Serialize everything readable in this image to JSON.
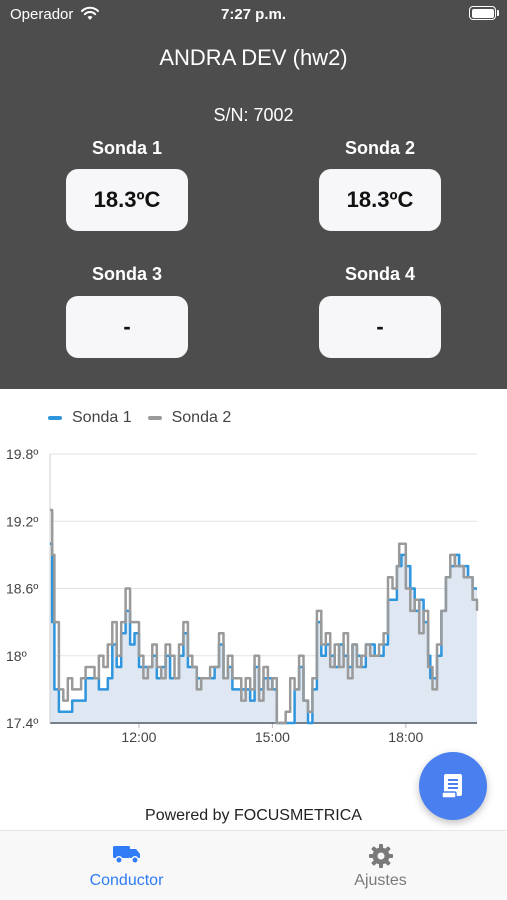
{
  "status_bar": {
    "carrier": "Operador",
    "time": "7:27 p.m."
  },
  "header": {
    "title": "ANDRA DEV (hw2)",
    "serial": "S/N: 7002"
  },
  "probes": [
    {
      "label": "Sonda 1",
      "value": "18.3ºC"
    },
    {
      "label": "Sonda 2",
      "value": "18.3ºC"
    },
    {
      "label": "Sonda 3",
      "value": "-"
    },
    {
      "label": "Sonda 4",
      "value": "-"
    }
  ],
  "colors": {
    "header_bg": "#4d4d4d",
    "sonda1": "#2f95dc",
    "sonda2": "#9a9a9a",
    "area_fill": "#dfe8f2",
    "accent": "#4a7ff0",
    "tab_active": "#2f7cf6",
    "tab_inactive": "#7a7a7a"
  },
  "chart_data": {
    "type": "line",
    "y_ticks": [
      "19.8º",
      "19.2º",
      "18.6º",
      "18º",
      "17.4º"
    ],
    "x_ticks": [
      "12:00",
      "15:00",
      "18:00"
    ],
    "ylim": [
      17.4,
      19.8
    ],
    "xlim": [
      10.0,
      19.6
    ],
    "grid": true,
    "legend_position": "top-left",
    "series": [
      {
        "name": "Sonda 1",
        "points": [
          [
            10.0,
            19.0
          ],
          [
            10.05,
            18.3
          ],
          [
            10.1,
            17.7
          ],
          [
            10.2,
            17.5
          ],
          [
            10.4,
            17.5
          ],
          [
            10.5,
            17.6
          ],
          [
            10.7,
            17.6
          ],
          [
            10.8,
            17.8
          ],
          [
            11.0,
            17.8
          ],
          [
            11.1,
            17.7
          ],
          [
            11.3,
            17.8
          ],
          [
            11.4,
            18.1
          ],
          [
            11.5,
            17.9
          ],
          [
            11.6,
            18.2
          ],
          [
            11.7,
            18.4
          ],
          [
            11.8,
            18.1
          ],
          [
            11.9,
            18.2
          ],
          [
            12.0,
            17.9
          ],
          [
            12.2,
            17.9
          ],
          [
            12.3,
            18.0
          ],
          [
            12.4,
            17.8
          ],
          [
            12.5,
            17.9
          ],
          [
            12.6,
            18.0
          ],
          [
            12.7,
            17.8
          ],
          [
            12.9,
            18.0
          ],
          [
            13.0,
            18.2
          ],
          [
            13.1,
            17.9
          ],
          [
            13.3,
            17.8
          ],
          [
            13.5,
            17.8
          ],
          [
            13.7,
            17.9
          ],
          [
            13.8,
            18.1
          ],
          [
            13.9,
            17.8
          ],
          [
            14.0,
            17.9
          ],
          [
            14.1,
            17.7
          ],
          [
            14.3,
            17.7
          ],
          [
            14.5,
            17.6
          ],
          [
            14.6,
            17.9
          ],
          [
            14.7,
            17.7
          ],
          [
            14.8,
            17.8
          ],
          [
            15.0,
            17.7
          ],
          [
            15.1,
            17.4
          ],
          [
            15.3,
            17.4
          ],
          [
            15.5,
            17.7
          ],
          [
            15.6,
            17.9
          ],
          [
            15.7,
            17.6
          ],
          [
            15.8,
            17.4
          ],
          [
            15.9,
            17.7
          ],
          [
            16.0,
            18.3
          ],
          [
            16.1,
            18.0
          ],
          [
            16.2,
            18.1
          ],
          [
            16.3,
            18.0
          ],
          [
            16.4,
            17.9
          ],
          [
            16.5,
            18.1
          ],
          [
            16.6,
            18.0
          ],
          [
            16.7,
            17.9
          ],
          [
            16.8,
            18.1
          ],
          [
            16.9,
            18.0
          ],
          [
            17.0,
            17.9
          ],
          [
            17.1,
            18.1
          ],
          [
            17.3,
            18.0
          ],
          [
            17.5,
            18.1
          ],
          [
            17.6,
            18.5
          ],
          [
            17.8,
            18.8
          ],
          [
            17.9,
            18.9
          ],
          [
            18.0,
            18.8
          ],
          [
            18.1,
            18.6
          ],
          [
            18.2,
            18.4
          ],
          [
            18.3,
            18.5
          ],
          [
            18.4,
            18.3
          ],
          [
            18.5,
            18.0
          ],
          [
            18.55,
            17.8
          ],
          [
            18.6,
            17.8
          ],
          [
            18.7,
            18.0
          ],
          [
            18.8,
            18.4
          ],
          [
            18.9,
            18.7
          ],
          [
            19.0,
            18.8
          ],
          [
            19.1,
            18.9
          ],
          [
            19.2,
            18.8
          ],
          [
            19.3,
            18.8
          ],
          [
            19.4,
            18.7
          ],
          [
            19.5,
            18.6
          ],
          [
            19.6,
            18.6
          ]
        ]
      },
      {
        "name": "Sonda 2",
        "points": [
          [
            10.0,
            19.3
          ],
          [
            10.05,
            18.9
          ],
          [
            10.1,
            18.3
          ],
          [
            10.2,
            17.7
          ],
          [
            10.3,
            17.6
          ],
          [
            10.4,
            17.8
          ],
          [
            10.5,
            17.7
          ],
          [
            10.6,
            17.7
          ],
          [
            10.7,
            17.8
          ],
          [
            10.8,
            17.9
          ],
          [
            11.0,
            17.8
          ],
          [
            11.1,
            18.0
          ],
          [
            11.2,
            17.9
          ],
          [
            11.3,
            18.1
          ],
          [
            11.4,
            18.3
          ],
          [
            11.5,
            18.0
          ],
          [
            11.6,
            18.3
          ],
          [
            11.7,
            18.6
          ],
          [
            11.8,
            18.3
          ],
          [
            11.9,
            18.3
          ],
          [
            12.0,
            18.0
          ],
          [
            12.1,
            17.8
          ],
          [
            12.2,
            17.9
          ],
          [
            12.3,
            18.1
          ],
          [
            12.4,
            17.9
          ],
          [
            12.5,
            17.8
          ],
          [
            12.6,
            18.1
          ],
          [
            12.7,
            18.0
          ],
          [
            12.8,
            17.8
          ],
          [
            12.9,
            18.1
          ],
          [
            13.0,
            18.3
          ],
          [
            13.1,
            18.0
          ],
          [
            13.2,
            17.9
          ],
          [
            13.3,
            17.7
          ],
          [
            13.4,
            17.8
          ],
          [
            13.5,
            17.8
          ],
          [
            13.6,
            17.9
          ],
          [
            13.7,
            17.9
          ],
          [
            13.8,
            18.2
          ],
          [
            13.9,
            17.8
          ],
          [
            14.0,
            18.0
          ],
          [
            14.1,
            17.8
          ],
          [
            14.2,
            17.8
          ],
          [
            14.3,
            17.6
          ],
          [
            14.4,
            17.8
          ],
          [
            14.5,
            17.7
          ],
          [
            14.6,
            18.0
          ],
          [
            14.7,
            17.6
          ],
          [
            14.8,
            17.9
          ],
          [
            14.9,
            17.7
          ],
          [
            15.0,
            17.8
          ],
          [
            15.1,
            17.4
          ],
          [
            15.3,
            17.5
          ],
          [
            15.4,
            17.8
          ],
          [
            15.5,
            17.7
          ],
          [
            15.6,
            18.0
          ],
          [
            15.7,
            17.6
          ],
          [
            15.8,
            17.5
          ],
          [
            15.9,
            17.8
          ],
          [
            16.0,
            18.4
          ],
          [
            16.1,
            18.1
          ],
          [
            16.2,
            18.2
          ],
          [
            16.3,
            17.9
          ],
          [
            16.4,
            18.1
          ],
          [
            16.5,
            17.9
          ],
          [
            16.6,
            18.2
          ],
          [
            16.7,
            17.8
          ],
          [
            16.8,
            18.1
          ],
          [
            16.9,
            17.9
          ],
          [
            17.0,
            18.0
          ],
          [
            17.1,
            18.1
          ],
          [
            17.2,
            18.0
          ],
          [
            17.3,
            18.0
          ],
          [
            17.4,
            18.1
          ],
          [
            17.5,
            18.2
          ],
          [
            17.6,
            18.7
          ],
          [
            17.7,
            18.6
          ],
          [
            17.8,
            18.8
          ],
          [
            17.85,
            19.0
          ],
          [
            17.9,
            19.0
          ],
          [
            18.0,
            18.6
          ],
          [
            18.1,
            18.4
          ],
          [
            18.2,
            18.5
          ],
          [
            18.3,
            18.2
          ],
          [
            18.4,
            18.4
          ],
          [
            18.5,
            17.9
          ],
          [
            18.6,
            17.7
          ],
          [
            18.7,
            18.1
          ],
          [
            18.8,
            18.4
          ],
          [
            18.9,
            18.7
          ],
          [
            19.0,
            18.9
          ],
          [
            19.1,
            18.8
          ],
          [
            19.2,
            18.8
          ],
          [
            19.3,
            18.7
          ],
          [
            19.4,
            18.7
          ],
          [
            19.5,
            18.5
          ],
          [
            19.6,
            18.4
          ]
        ]
      }
    ]
  },
  "footer": {
    "powered": "Powered by FOCUSMETRICA"
  },
  "tabs": [
    {
      "label": "Conductor",
      "icon": "truck-icon",
      "active": true
    },
    {
      "label": "Ajustes",
      "icon": "gear-icon",
      "active": false
    }
  ]
}
